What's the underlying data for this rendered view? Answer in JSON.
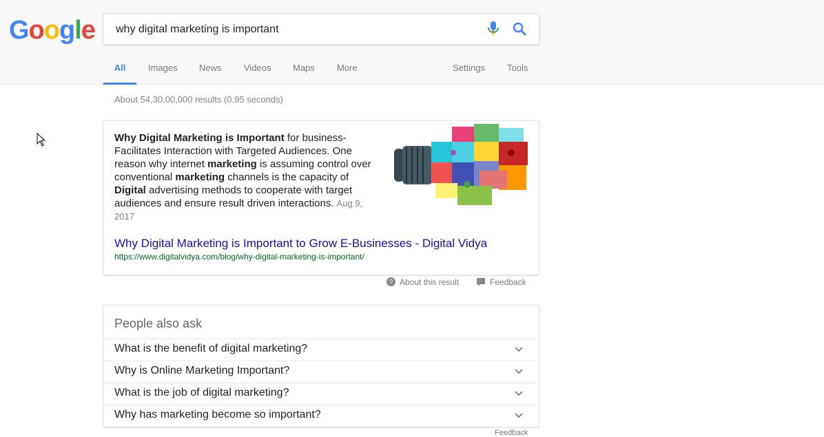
{
  "logo": {
    "letters": [
      "G",
      "o",
      "o",
      "g",
      "l",
      "e"
    ],
    "colors": [
      "#4285F4",
      "#EA4335",
      "#FBBC05",
      "#4285F4",
      "#34A853",
      "#EA4335"
    ]
  },
  "search": {
    "query": "why digital marketing is important",
    "mic_icon": "mic-icon",
    "search_icon": "search-icon"
  },
  "tabs": [
    {
      "label": "All",
      "active": true
    },
    {
      "label": "Images"
    },
    {
      "label": "News"
    },
    {
      "label": "Videos"
    },
    {
      "label": "Maps"
    },
    {
      "label": "More"
    },
    {
      "label": "Settings"
    },
    {
      "label": "Tools"
    }
  ],
  "stats": "About 54,30,00,000 results (0.95 seconds)",
  "featured": {
    "snippet_parts": [
      {
        "text": "Why Digital Marketing is Important",
        "bold": true
      },
      {
        "text": " for business- Facilitates Interaction with Targeted Audiences. One reason why internet ",
        "bold": false
      },
      {
        "text": "marketing",
        "bold": true
      },
      {
        "text": " is assuming control over conventional ",
        "bold": false
      },
      {
        "text": "marketing",
        "bold": true
      },
      {
        "text": " channels is the capacity of ",
        "bold": false
      },
      {
        "text": "Digital",
        "bold": true
      },
      {
        "text": " advertising methods to cooperate with target audiences and ensure result driven interactions.",
        "bold": false
      }
    ],
    "date": "Aug 9, 2017",
    "title": "Why Digital Marketing is Important to Grow E-Businesses - Digital Vidya",
    "url": "https://www.digitalvidya.com/blog/why-digital-marketing-is-important/",
    "about": "About this result",
    "feedback": "Feedback"
  },
  "paa": {
    "title": "People also ask",
    "questions": [
      "What is the benefit of digital marketing?",
      "Why is Online Marketing Important?",
      "What is the job of digital marketing?",
      "Why has marketing become so important?"
    ],
    "feedback": "Feedback"
  },
  "colors": {
    "link": "#1a0dab",
    "url": "#006621",
    "accent": "#4285f4"
  }
}
